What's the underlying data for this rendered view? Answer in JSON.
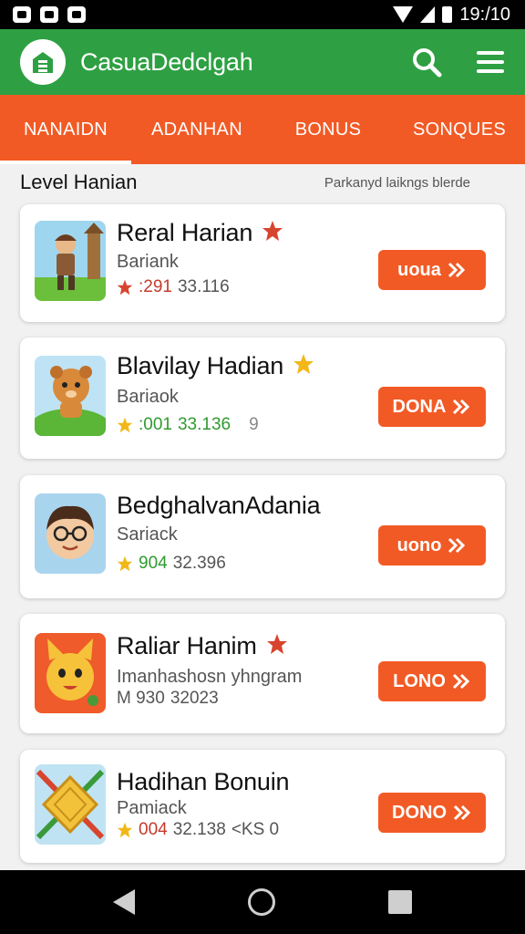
{
  "status_bar": {
    "time": "19:/10"
  },
  "app_bar": {
    "title": "CasuaDedclgah",
    "logo_icon": "store-icon",
    "search_icon": "search-icon",
    "menu_icon": "menu-icon"
  },
  "tabs": [
    {
      "label": "NANAIDN",
      "active": true
    },
    {
      "label": "ADANHAN",
      "active": false
    },
    {
      "label": "BONUS",
      "active": false
    },
    {
      "label": "SONQUES",
      "active": false
    }
  ],
  "section": {
    "title": "Level Hanian",
    "subtitle": "Parkanyd laikngs blerde"
  },
  "cards": [
    {
      "title": "Reral Harian",
      "subtitle": "Bariank",
      "stat": ":291",
      "stat2": "33.116",
      "extra": "",
      "button": "uoua",
      "badge_color": "#d8452f"
    },
    {
      "title": "Blavilay Hadian",
      "subtitle": "Bariaok",
      "stat": ":001",
      "stat2": "33.136",
      "extra": "9",
      "button": "DONA",
      "badge_color": "#f2b818"
    },
    {
      "title": "BedghalvanAdania",
      "subtitle": "Sariack",
      "stat": "904",
      "stat2": "32.396",
      "extra": "",
      "button": "uono",
      "badge_color": ""
    },
    {
      "title": "Raliar Hanim",
      "subtitle": "Imanhashosn yhngram",
      "stat": "M 930",
      "stat2": "32023",
      "extra": "",
      "button": "LONO",
      "badge_color": "#d8452f"
    },
    {
      "title": "Hadihan Bonuin",
      "subtitle": "Pamiack",
      "stat": "004",
      "stat2": "32.138",
      "extra": "<KS 0",
      "button": "DONO",
      "badge_color": ""
    }
  ],
  "colors": {
    "green": "#2ea043",
    "orange": "#f25a25"
  }
}
